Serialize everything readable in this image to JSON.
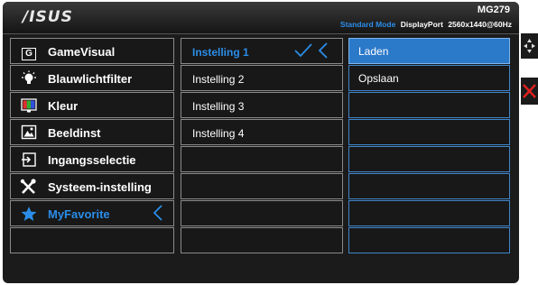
{
  "header": {
    "brand": "/ISUS",
    "model": "MG279",
    "mode": "Standard Mode",
    "port": "DisplayPort",
    "resolution": "2560x1440@60Hz"
  },
  "menu": {
    "items": [
      {
        "label": "GameVisual",
        "icon": "gamevisual-icon"
      },
      {
        "label": "Blauwlichtfilter",
        "icon": "bulb-icon"
      },
      {
        "label": "Kleur",
        "icon": "color-icon"
      },
      {
        "label": "Beeldinst",
        "icon": "image-icon"
      },
      {
        "label": "Ingangsselectie",
        "icon": "input-icon"
      },
      {
        "label": "Systeem-instelling",
        "icon": "tools-icon"
      },
      {
        "label": "MyFavorite",
        "icon": "star-icon"
      }
    ],
    "active_index": 6
  },
  "submenu": {
    "items": [
      "Instelling 1",
      "Instelling 2",
      "Instelling 3",
      "Instelling 4"
    ],
    "selected_index": 0
  },
  "actions": {
    "items": [
      "Laden",
      "Opslaan"
    ],
    "highlight_index": 0
  },
  "colors": {
    "accent": "#2b8de8",
    "close": "#e02020"
  }
}
